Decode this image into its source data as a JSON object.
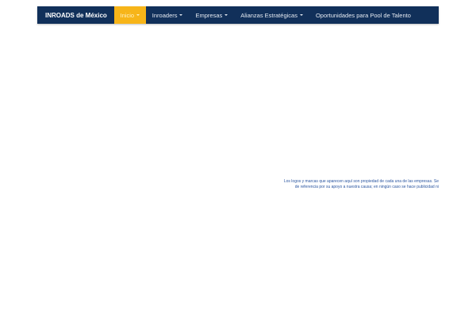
{
  "navbar": {
    "brand": "INROADS de México",
    "items": [
      {
        "label": "Inicio",
        "active": true,
        "dropdown": true
      },
      {
        "label": "Inroaders",
        "active": false,
        "dropdown": true
      },
      {
        "label": "Empresas",
        "active": false,
        "dropdown": true
      },
      {
        "label": "Alianzas Estratégicas",
        "active": false,
        "dropdown": true
      },
      {
        "label": "Oportunidades para Pool de Talento",
        "active": false,
        "dropdown": false
      }
    ],
    "colors": {
      "background": "#11305a",
      "active": "#f7b519"
    }
  },
  "disclaimer": {
    "line1": "Los logos y marcas que aparecen aquí son propiedad de cada una de las empresas. Se",
    "line2": "de referencia por su apoyo a nuestra causa; en ningún caso se hace publicidad ni",
    "color": "#2b56a0"
  }
}
